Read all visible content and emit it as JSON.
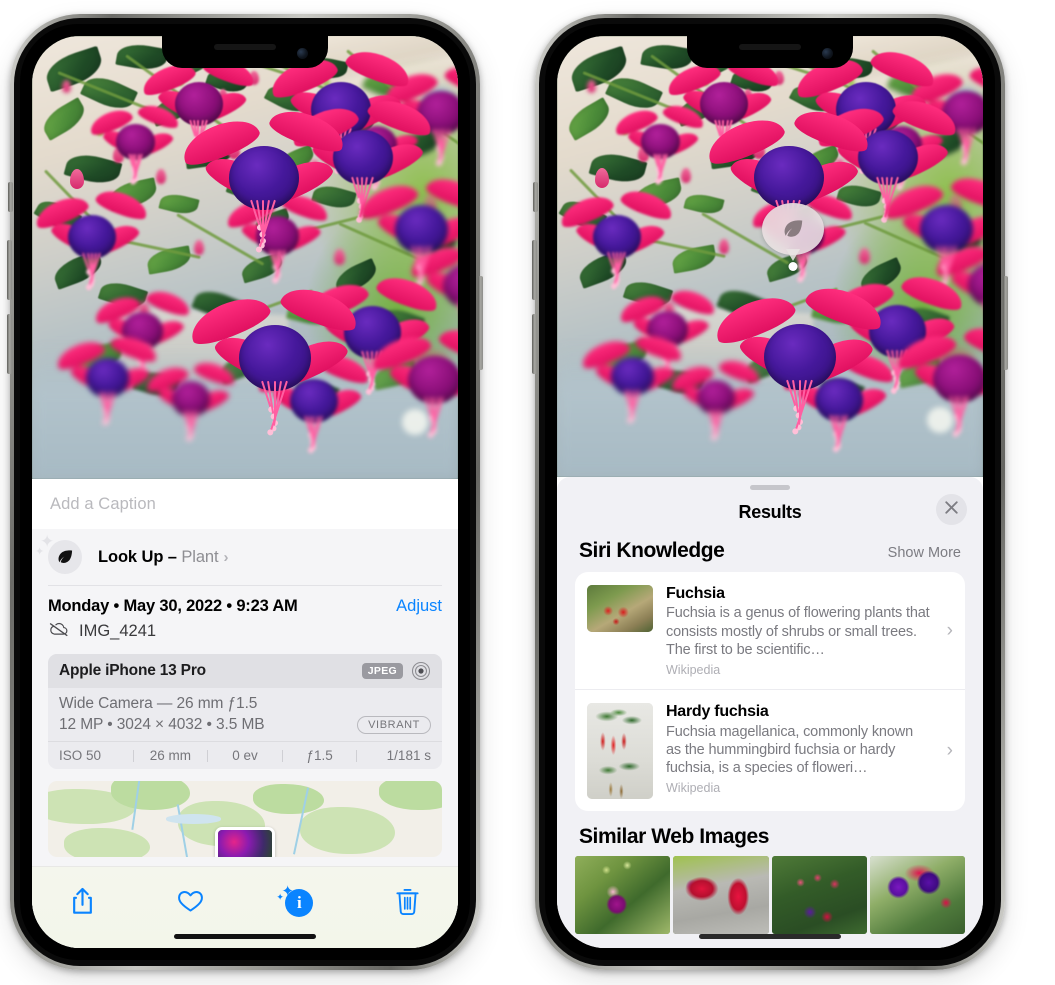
{
  "left_phone": {
    "caption_field": {
      "placeholder": "Add a Caption",
      "value": ""
    },
    "lookup": {
      "icon": "leaf-icon",
      "label": "Look Up – ",
      "subject": "Plant",
      "chevron": "›"
    },
    "metadata": {
      "date": "Monday • May 30, 2022 • 9:23 AM",
      "adjust_label": "Adjust",
      "cloud_icon": "cloud-slash-icon",
      "filename": "IMG_4241"
    },
    "camera_card": {
      "model": "Apple iPhone 13 Pro",
      "format_tag": "JPEG",
      "lens_icon": "lens-icon",
      "lens_line": "Wide Camera — 26 mm ƒ1.5",
      "size_line": "12 MP • 3024 × 4032 • 3.5 MB",
      "style_tag": "VIBRANT",
      "exif": [
        "ISO 50",
        "26 mm",
        "0 ev",
        "ƒ1.5",
        "1/181 s"
      ]
    },
    "map": {
      "pin_label": "photo-location-pin"
    },
    "toolbar": [
      {
        "name": "share-button",
        "icon": "share-icon"
      },
      {
        "name": "favorite-button",
        "icon": "heart-icon"
      },
      {
        "name": "info-button",
        "icon": "info-sparkle-icon",
        "glyph": "i"
      },
      {
        "name": "delete-button",
        "icon": "trash-icon"
      }
    ]
  },
  "right_phone": {
    "lookup_bubble": {
      "icon": "leaf-icon"
    },
    "sheet": {
      "title": "Results",
      "close_icon": "close-icon",
      "sections": [
        {
          "title": "Siri Knowledge",
          "action_label": "Show More",
          "items": [
            {
              "title": "Fuchsia",
              "description": "Fuchsia is a genus of flowering plants that consists mostly of shrubs or small trees. The first to be scientific…",
              "source": "Wikipedia",
              "chevron": "›"
            },
            {
              "title": "Hardy fuchsia",
              "description": "Fuchsia magellanica, commonly known as the hummingbird fuchsia or hardy fuchsia, is a species of floweri…",
              "source": "Wikipedia",
              "chevron": "›"
            }
          ]
        },
        {
          "title": "Similar Web Images",
          "items": [
            {
              "name": "web-image-1"
            },
            {
              "name": "web-image-2"
            },
            {
              "name": "web-image-3"
            },
            {
              "name": "web-image-4"
            }
          ]
        }
      ]
    }
  },
  "colors": {
    "accent_blue": "#0a84ff",
    "sheet_bg": "#f1f1f5",
    "info_bg": "#f5f5f7",
    "card_bg": "#ebebef",
    "secondary_text": "#8e8e93",
    "toolbar_bg": "#f4f6ed"
  }
}
